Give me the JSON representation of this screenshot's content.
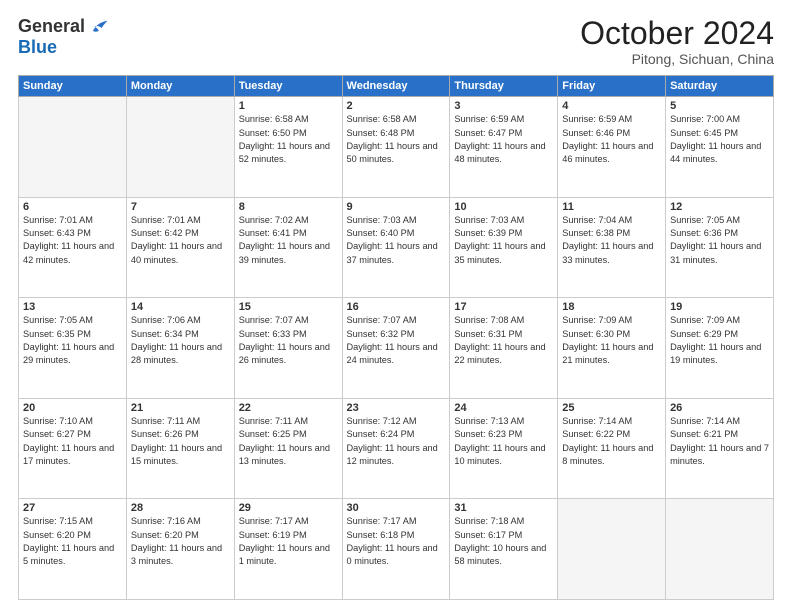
{
  "header": {
    "logo_general": "General",
    "logo_blue": "Blue",
    "month_title": "October 2024",
    "location": "Pitong, Sichuan, China"
  },
  "weekdays": [
    "Sunday",
    "Monday",
    "Tuesday",
    "Wednesday",
    "Thursday",
    "Friday",
    "Saturday"
  ],
  "weeks": [
    [
      {
        "day": "",
        "sunrise": "",
        "sunset": "",
        "daylight": "",
        "empty": true
      },
      {
        "day": "",
        "sunrise": "",
        "sunset": "",
        "daylight": "",
        "empty": true
      },
      {
        "day": "1",
        "sunrise": "Sunrise: 6:58 AM",
        "sunset": "Sunset: 6:50 PM",
        "daylight": "Daylight: 11 hours and 52 minutes.",
        "empty": false
      },
      {
        "day": "2",
        "sunrise": "Sunrise: 6:58 AM",
        "sunset": "Sunset: 6:48 PM",
        "daylight": "Daylight: 11 hours and 50 minutes.",
        "empty": false
      },
      {
        "day": "3",
        "sunrise": "Sunrise: 6:59 AM",
        "sunset": "Sunset: 6:47 PM",
        "daylight": "Daylight: 11 hours and 48 minutes.",
        "empty": false
      },
      {
        "day": "4",
        "sunrise": "Sunrise: 6:59 AM",
        "sunset": "Sunset: 6:46 PM",
        "daylight": "Daylight: 11 hours and 46 minutes.",
        "empty": false
      },
      {
        "day": "5",
        "sunrise": "Sunrise: 7:00 AM",
        "sunset": "Sunset: 6:45 PM",
        "daylight": "Daylight: 11 hours and 44 minutes.",
        "empty": false
      }
    ],
    [
      {
        "day": "6",
        "sunrise": "Sunrise: 7:01 AM",
        "sunset": "Sunset: 6:43 PM",
        "daylight": "Daylight: 11 hours and 42 minutes.",
        "empty": false
      },
      {
        "day": "7",
        "sunrise": "Sunrise: 7:01 AM",
        "sunset": "Sunset: 6:42 PM",
        "daylight": "Daylight: 11 hours and 40 minutes.",
        "empty": false
      },
      {
        "day": "8",
        "sunrise": "Sunrise: 7:02 AM",
        "sunset": "Sunset: 6:41 PM",
        "daylight": "Daylight: 11 hours and 39 minutes.",
        "empty": false
      },
      {
        "day": "9",
        "sunrise": "Sunrise: 7:03 AM",
        "sunset": "Sunset: 6:40 PM",
        "daylight": "Daylight: 11 hours and 37 minutes.",
        "empty": false
      },
      {
        "day": "10",
        "sunrise": "Sunrise: 7:03 AM",
        "sunset": "Sunset: 6:39 PM",
        "daylight": "Daylight: 11 hours and 35 minutes.",
        "empty": false
      },
      {
        "day": "11",
        "sunrise": "Sunrise: 7:04 AM",
        "sunset": "Sunset: 6:38 PM",
        "daylight": "Daylight: 11 hours and 33 minutes.",
        "empty": false
      },
      {
        "day": "12",
        "sunrise": "Sunrise: 7:05 AM",
        "sunset": "Sunset: 6:36 PM",
        "daylight": "Daylight: 11 hours and 31 minutes.",
        "empty": false
      }
    ],
    [
      {
        "day": "13",
        "sunrise": "Sunrise: 7:05 AM",
        "sunset": "Sunset: 6:35 PM",
        "daylight": "Daylight: 11 hours and 29 minutes.",
        "empty": false
      },
      {
        "day": "14",
        "sunrise": "Sunrise: 7:06 AM",
        "sunset": "Sunset: 6:34 PM",
        "daylight": "Daylight: 11 hours and 28 minutes.",
        "empty": false
      },
      {
        "day": "15",
        "sunrise": "Sunrise: 7:07 AM",
        "sunset": "Sunset: 6:33 PM",
        "daylight": "Daylight: 11 hours and 26 minutes.",
        "empty": false
      },
      {
        "day": "16",
        "sunrise": "Sunrise: 7:07 AM",
        "sunset": "Sunset: 6:32 PM",
        "daylight": "Daylight: 11 hours and 24 minutes.",
        "empty": false
      },
      {
        "day": "17",
        "sunrise": "Sunrise: 7:08 AM",
        "sunset": "Sunset: 6:31 PM",
        "daylight": "Daylight: 11 hours and 22 minutes.",
        "empty": false
      },
      {
        "day": "18",
        "sunrise": "Sunrise: 7:09 AM",
        "sunset": "Sunset: 6:30 PM",
        "daylight": "Daylight: 11 hours and 21 minutes.",
        "empty": false
      },
      {
        "day": "19",
        "sunrise": "Sunrise: 7:09 AM",
        "sunset": "Sunset: 6:29 PM",
        "daylight": "Daylight: 11 hours and 19 minutes.",
        "empty": false
      }
    ],
    [
      {
        "day": "20",
        "sunrise": "Sunrise: 7:10 AM",
        "sunset": "Sunset: 6:27 PM",
        "daylight": "Daylight: 11 hours and 17 minutes.",
        "empty": false
      },
      {
        "day": "21",
        "sunrise": "Sunrise: 7:11 AM",
        "sunset": "Sunset: 6:26 PM",
        "daylight": "Daylight: 11 hours and 15 minutes.",
        "empty": false
      },
      {
        "day": "22",
        "sunrise": "Sunrise: 7:11 AM",
        "sunset": "Sunset: 6:25 PM",
        "daylight": "Daylight: 11 hours and 13 minutes.",
        "empty": false
      },
      {
        "day": "23",
        "sunrise": "Sunrise: 7:12 AM",
        "sunset": "Sunset: 6:24 PM",
        "daylight": "Daylight: 11 hours and 12 minutes.",
        "empty": false
      },
      {
        "day": "24",
        "sunrise": "Sunrise: 7:13 AM",
        "sunset": "Sunset: 6:23 PM",
        "daylight": "Daylight: 11 hours and 10 minutes.",
        "empty": false
      },
      {
        "day": "25",
        "sunrise": "Sunrise: 7:14 AM",
        "sunset": "Sunset: 6:22 PM",
        "daylight": "Daylight: 11 hours and 8 minutes.",
        "empty": false
      },
      {
        "day": "26",
        "sunrise": "Sunrise: 7:14 AM",
        "sunset": "Sunset: 6:21 PM",
        "daylight": "Daylight: 11 hours and 7 minutes.",
        "empty": false
      }
    ],
    [
      {
        "day": "27",
        "sunrise": "Sunrise: 7:15 AM",
        "sunset": "Sunset: 6:20 PM",
        "daylight": "Daylight: 11 hours and 5 minutes.",
        "empty": false
      },
      {
        "day": "28",
        "sunrise": "Sunrise: 7:16 AM",
        "sunset": "Sunset: 6:20 PM",
        "daylight": "Daylight: 11 hours and 3 minutes.",
        "empty": false
      },
      {
        "day": "29",
        "sunrise": "Sunrise: 7:17 AM",
        "sunset": "Sunset: 6:19 PM",
        "daylight": "Daylight: 11 hours and 1 minute.",
        "empty": false
      },
      {
        "day": "30",
        "sunrise": "Sunrise: 7:17 AM",
        "sunset": "Sunset: 6:18 PM",
        "daylight": "Daylight: 11 hours and 0 minutes.",
        "empty": false
      },
      {
        "day": "31",
        "sunrise": "Sunrise: 7:18 AM",
        "sunset": "Sunset: 6:17 PM",
        "daylight": "Daylight: 10 hours and 58 minutes.",
        "empty": false
      },
      {
        "day": "",
        "sunrise": "",
        "sunset": "",
        "daylight": "",
        "empty": true
      },
      {
        "day": "",
        "sunrise": "",
        "sunset": "",
        "daylight": "",
        "empty": true
      }
    ]
  ]
}
